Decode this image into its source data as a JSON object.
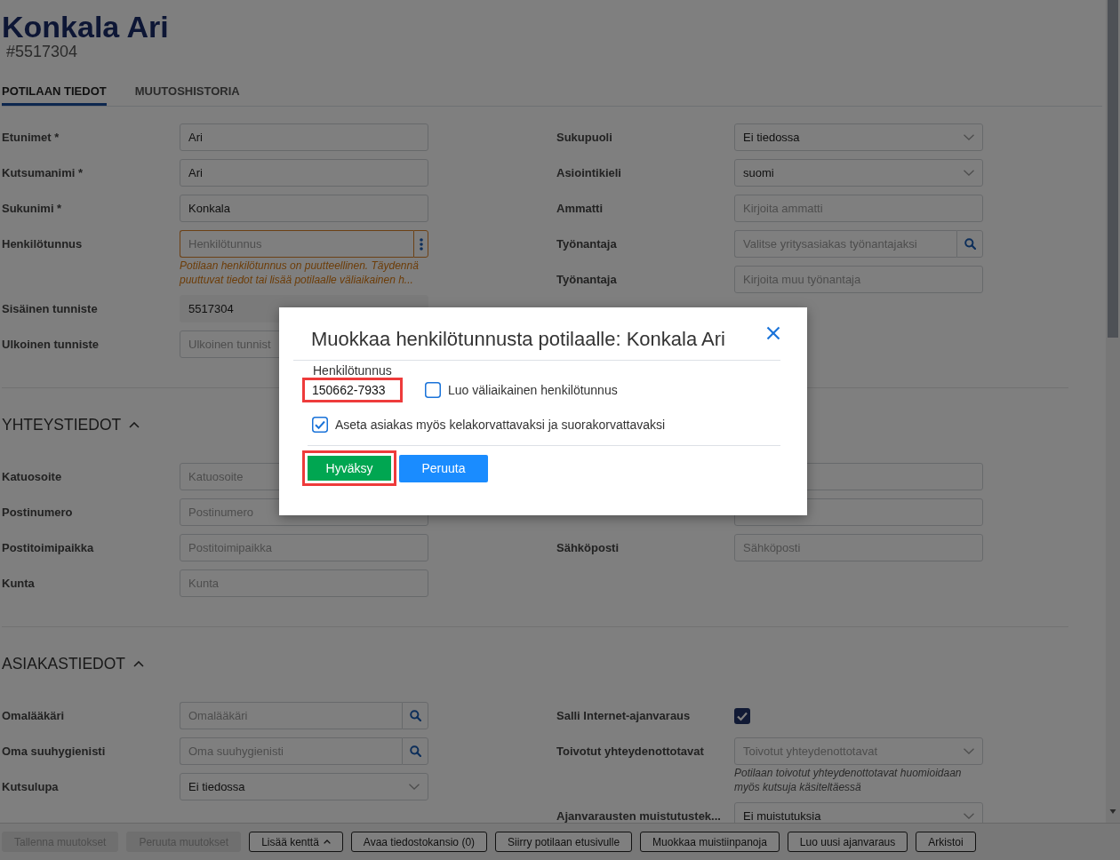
{
  "header": {
    "name": "Konkala Ari",
    "patient_number": "#5517304"
  },
  "tabs": [
    {
      "label": "POTILAAN TIEDOT",
      "selected": true
    },
    {
      "label": "MUUTOSHISTORIA",
      "selected": false
    }
  ],
  "sections": [
    {
      "left": [
        {
          "label": "Etunimet *",
          "kind": "input",
          "value": "Ari"
        },
        {
          "label": "Kutsumanimi *",
          "kind": "input",
          "value": "Ari"
        },
        {
          "label": "Sukunimi *",
          "kind": "input",
          "value": "Konkala"
        },
        {
          "label": "Henkilötunnus",
          "kind": "menu-input",
          "placeholder": "Henkilötunnus",
          "warning": true,
          "message": "Potilaan henkilötunnus on puutteellinen. Täydennä puuttuvat tiedot tai lisää potilaalle väliaikainen h..."
        },
        {
          "label": "Sisäinen tunniste",
          "kind": "readonly",
          "value": "5517304"
        },
        {
          "label": "Ulkoinen tunniste",
          "kind": "input",
          "placeholder": "Ulkoinen tunnist"
        }
      ],
      "right": [
        {
          "label": "Sukupuoli",
          "kind": "select",
          "value": "Ei tiedossa"
        },
        {
          "label": "Asiointikieli",
          "kind": "select",
          "value": "suomi"
        },
        {
          "label": "Ammatti",
          "kind": "input",
          "placeholder": "Kirjoita ammatti"
        },
        {
          "label": "Työnantaja",
          "kind": "search",
          "placeholder": "Valitse yritysasiakas työnantajaksi"
        },
        {
          "label": "Työnantaja",
          "kind": "input",
          "placeholder": "Kirjoita muu työnantaja"
        }
      ]
    },
    {
      "title": "YHTEYSTIEDOT",
      "expanded": true,
      "left": [
        {
          "label": "Katuosoite",
          "kind": "input",
          "placeholder": "Katuosoite"
        },
        {
          "label": "Postinumero",
          "kind": "input",
          "placeholder": "Postinumero"
        },
        {
          "label": "Postitoimipaikka",
          "kind": "input",
          "placeholder": "Postitoimipaikka"
        },
        {
          "label": "Kunta",
          "kind": "input",
          "placeholder": "Kunta"
        }
      ],
      "right": [
        {
          "kind": "input"
        },
        {
          "kind": "input"
        },
        {
          "label": "Sähköposti",
          "kind": "input",
          "placeholder": "Sähköposti"
        }
      ]
    },
    {
      "title": "ASIAKASTIEDOT",
      "expanded": true,
      "left": [
        {
          "label": "Omalääkäri",
          "kind": "search",
          "placeholder": "Omalääkäri"
        },
        {
          "label": "Oma suuhygienisti",
          "kind": "search",
          "placeholder": "Oma suuhygienisti"
        },
        {
          "label": "Kutsulupa",
          "kind": "select",
          "value": "Ei tiedossa"
        }
      ],
      "right": [
        {
          "label": "Salli Internet-ajanvaraus",
          "kind": "checkbox",
          "checked": true
        },
        {
          "label": "Toivotut yhteydenottotavat",
          "kind": "select",
          "placeholder": "Toivotut yhteydenottotavat",
          "hint": "Potilaan toivotut yhteydenottotavat huomioidaan myös kutsuja käsiteltäessä"
        },
        {
          "label": "Ajanvarausten muistutustek...",
          "kind": "select",
          "value": "Ei muistutuksia"
        }
      ]
    }
  ],
  "footer_buttons": [
    {
      "label": "Tallenna muutokset",
      "disabled": true,
      "dropdown": false
    },
    {
      "label": "Peruuta muutokset",
      "disabled": true,
      "dropdown": false
    },
    {
      "label": "Lisää kenttä",
      "disabled": false,
      "dropdown": true
    },
    {
      "label": "Avaa tiedostokansio (0)",
      "disabled": false,
      "dropdown": false
    },
    {
      "label": "Siirry potilaan etusivulle",
      "disabled": false,
      "dropdown": false
    },
    {
      "label": "Muokkaa muistiinpanoja",
      "disabled": false,
      "dropdown": false
    },
    {
      "label": "Luo uusi ajanvaraus",
      "disabled": false,
      "dropdown": false
    },
    {
      "label": "Arkistoi",
      "disabled": false,
      "dropdown": false
    }
  ],
  "dialog": {
    "title": "Muokkaa henkilötunnusta potilaalle: Konkala Ari",
    "field": {
      "label": "Henkilötunnus",
      "value": "150662-7933",
      "highlighted": true
    },
    "options": [
      {
        "label": "Luo väliaikainen henkilötunnus",
        "checked": false
      },
      {
        "label": "Aseta asiakas myös kelakorvattavaksi ja suorakorvattavaksi",
        "checked": true
      }
    ],
    "buttons": [
      {
        "label": "Hyväksy",
        "kind": "confirm",
        "highlighted": true
      },
      {
        "label": "Peruuta",
        "kind": "cancel",
        "highlighted": false
      }
    ]
  }
}
